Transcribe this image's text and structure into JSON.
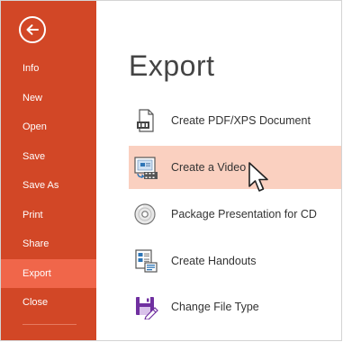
{
  "sidebar": {
    "back_icon": "back-arrow-icon",
    "items": [
      {
        "label": "Info"
      },
      {
        "label": "New"
      },
      {
        "label": "Open"
      },
      {
        "label": "Save"
      },
      {
        "label": "Save As"
      },
      {
        "label": "Print"
      },
      {
        "label": "Share"
      },
      {
        "label": "Export",
        "active": true
      },
      {
        "label": "Close"
      }
    ]
  },
  "main": {
    "title": "Export",
    "options": [
      {
        "label": "Create PDF/XPS Document",
        "icon": "pdf-document-icon"
      },
      {
        "label": "Create a Video",
        "icon": "video-icon",
        "selected": true
      },
      {
        "label": "Package Presentation for CD",
        "icon": "cd-icon"
      },
      {
        "label": "Create Handouts",
        "icon": "handouts-icon"
      },
      {
        "label": "Change File Type",
        "icon": "file-type-icon"
      }
    ]
  },
  "colors": {
    "sidebar_bg": "#d24726",
    "sidebar_active": "#f0664a",
    "selected_option_bg": "#fad0c0",
    "text": "#333333"
  }
}
